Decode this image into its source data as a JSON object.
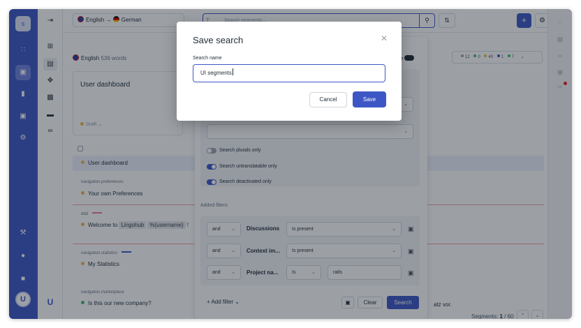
{
  "rail": {
    "logo_letter": "s",
    "items": [
      "apps-icon",
      "box-icon",
      "chart-icon",
      "cart-icon",
      "gear-icon"
    ],
    "bottom": [
      "wrench-icon",
      "bell-icon",
      "message-icon"
    ],
    "avatar_letter": "U"
  },
  "topbar": {
    "source_lang": "English",
    "target_lang": "German",
    "lang_arrow": "→",
    "search_type": "T",
    "search_placeholder": "Search segments...",
    "plus": "+"
  },
  "content": {
    "lang_name": "English",
    "word_count": "536 words",
    "card_title": "User dashboard",
    "card_status": "Draft",
    "stats": [
      {
        "color": "#9aa3b2",
        "value": "12"
      },
      {
        "color": "#3fba6b",
        "value": "0"
      },
      {
        "color": "#f0b64a",
        "value": "40"
      },
      {
        "color": "#3d56c5",
        "value": "1"
      },
      {
        "color": "#3fba6b",
        "value": "7"
      }
    ],
    "rows": [
      {
        "key": "",
        "text": "User dashboard"
      },
      {
        "key": "navigation.preferences",
        "text": "Your own Preferences"
      },
      {
        "key": "ddd",
        "text_pre": "Welcome to",
        "tag1": "Lingohub",
        "tag2": "%{username}",
        "text_post": "!"
      },
      {
        "key": "navigation.statistics",
        "text": "My Statistics"
      },
      {
        "key": "navigation.marketplace",
        "text": "Is this our new company?"
      }
    ],
    "trailing_text": "atz vor.",
    "segments_label": "Segments:",
    "segments_current": "1",
    "segments_total": "/ 60"
  },
  "filter_panel": {
    "live_label": "ve",
    "toggles": [
      {
        "label": "Search plurals only",
        "on": false
      },
      {
        "label": "Search untranslatable only",
        "on": true
      },
      {
        "label": "Search deactivated only",
        "on": true
      }
    ],
    "added_filters_label": "Added filters",
    "filters": [
      {
        "op": "and",
        "name": "Discussions",
        "cond": "Is present",
        "value": ""
      },
      {
        "op": "and",
        "name": "Context im...",
        "cond": "Is present",
        "value": ""
      },
      {
        "op": "and",
        "name": "Project na...",
        "cond": "Is",
        "value": "rails"
      }
    ],
    "add_filter": "+ Add filter",
    "clear": "Clear",
    "search": "Search"
  },
  "modal": {
    "title": "Save search",
    "field_label": "Search name",
    "field_value": "UI segments",
    "cancel": "Cancel",
    "save": "Save"
  }
}
